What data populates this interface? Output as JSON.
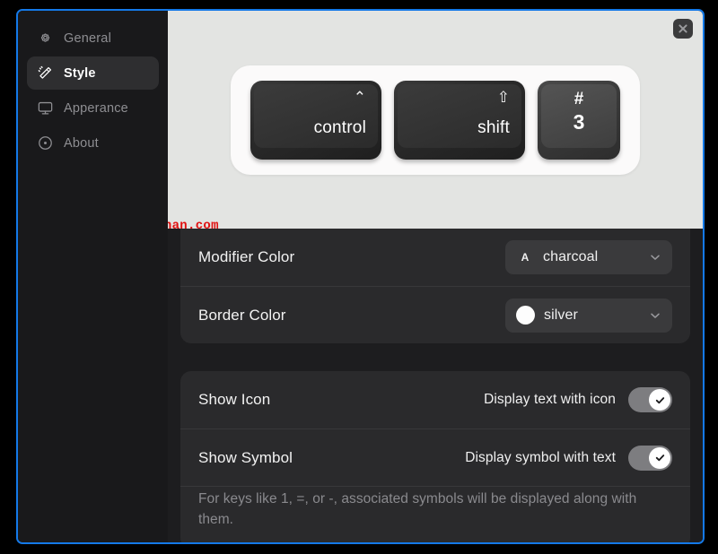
{
  "sidebar": {
    "items": [
      {
        "label": "General",
        "icon": "gear-icon",
        "active": false
      },
      {
        "label": "Style",
        "icon": "wand-icon",
        "active": true
      },
      {
        "label": "Apperance",
        "icon": "monitor-icon",
        "active": false
      },
      {
        "label": "About",
        "icon": "info-icon",
        "active": false
      }
    ]
  },
  "window": {
    "close_label": "✕",
    "accent": "#1479e8"
  },
  "preview": {
    "background": "#e3e4e2",
    "panel_background": "#fbfafa",
    "keys": [
      {
        "symbol": "⌃",
        "label": "control",
        "type": "modifier",
        "color": "#2f2f2f"
      },
      {
        "symbol": "⇧",
        "label": "shift",
        "type": "modifier",
        "color": "#2f2f2f"
      },
      {
        "top": "#",
        "bottom": "3",
        "type": "key",
        "color": "#4a4a4a"
      }
    ]
  },
  "watermark": {
    "text": "yinghezhan.com",
    "color": "#e01010"
  },
  "settings": {
    "group1": [
      {
        "title": "Modifier Color",
        "control": "dropdown",
        "swatch_type": "letter",
        "swatch_letter": "A",
        "value": "charcoal"
      },
      {
        "title": "Border Color",
        "control": "dropdown",
        "swatch_type": "circle",
        "swatch_color": "#fdfdfd",
        "value": "silver"
      }
    ],
    "group2": [
      {
        "title": "Show Icon",
        "control": "toggle",
        "subtitle": "Display text with icon",
        "checked": true
      },
      {
        "title": "Show Symbol",
        "control": "toggle",
        "subtitle": "Display symbol with text",
        "checked": true
      }
    ],
    "group2_note": "For keys like 1, =, or -, associated symbols will be displayed along with them."
  }
}
